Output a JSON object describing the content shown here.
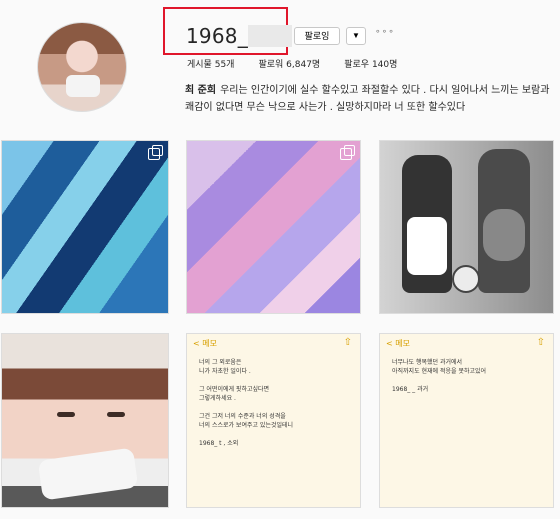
{
  "profile": {
    "handle_visible": "1968_",
    "follow_label": "팔로잉",
    "dropdown_label": "▼",
    "more_label": "∘∘∘",
    "stats": [
      {
        "label": "게시물",
        "value": "55개"
      },
      {
        "label": "팔로워",
        "value": "6,847명"
      },
      {
        "label": "팔로우",
        "value": "140명"
      }
    ],
    "bio_name": "최 준희",
    "bio_text": "우리는 인간이기에 실수 할수있고 좌절할수 있다 . 다시 일어나서 느끼는 보람과 쾌감이 없다면 무슨 낙으로 사는가 . 실망하지마라 너 또한 할수있다"
  },
  "memo1": {
    "header": "< 메모",
    "lines": [
      "너의 그 외로움은",
      "니가 자초한 일이다 .",
      "",
      "그 어떤이에게 핏하고싶다면",
      "그렇게하세요 .",
      "",
      "그건 그저 너의 수준과 너의 성격을",
      "너의 스스로가 보여주고 있는것일테니",
      "",
      "1968_      t , 소외"
    ]
  },
  "memo2": {
    "header": "< 메모",
    "lines": [
      "너무나도 행복했던 과거에서",
      "아직까지도 현재에 적응을 못하고있어",
      "",
      "1968_      _ 과거"
    ]
  },
  "images": {
    "painting_blue": "blue abstract painting",
    "painting_purple": "purple abstract painting",
    "energy_drinks": "energy drink bottles",
    "selfie": "portrait photo"
  }
}
